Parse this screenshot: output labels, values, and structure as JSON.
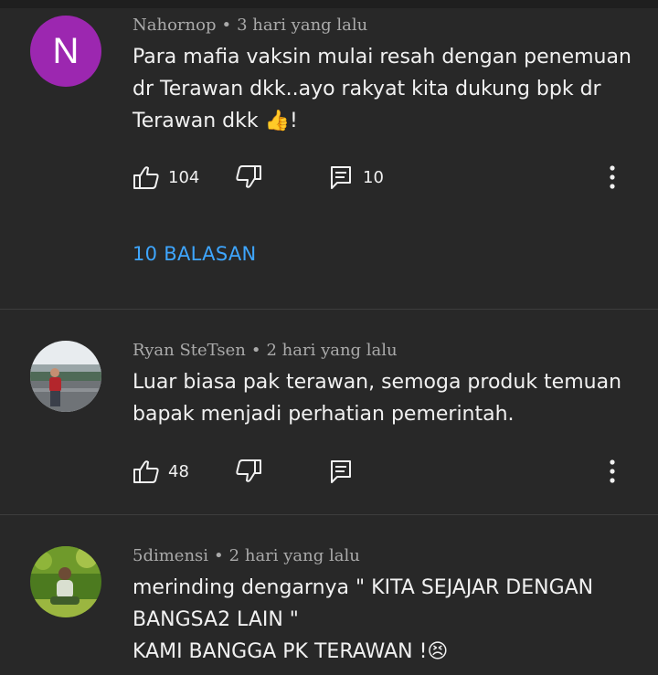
{
  "comments": [
    {
      "author": "Nahornop",
      "time": "3 hari yang lalu",
      "avatar_letter": "N",
      "avatar_color": "#9c27b0",
      "lines": [
        "Para mafia vaksin mulai resah dengan penemuan",
        "dr Terawan dkk..ayo rakyat kita dukung bpk dr",
        "Terawan dkk 👍!"
      ],
      "likes": "104",
      "replies_count": "10",
      "replies_label": "10 BALASAN"
    },
    {
      "author": "Ryan SteTsen",
      "time": "2 hari yang lalu",
      "avatar_image": "person-photo-outdoor",
      "lines": [
        "Luar biasa pak terawan, semoga produk temuan",
        "bapak menjadi perhatian pemerintah."
      ],
      "likes": "48"
    },
    {
      "author": "5dimensi",
      "time": "2 hari yang lalu",
      "avatar_image": "person-photo-grass",
      "lines": [
        "merinding dengarnya \" KITA SEJAJAR DENGAN",
        "BANGSA2 LAIN \"",
        "KAMI BANGGA PK TERAWAN !😣"
      ]
    }
  ],
  "separator": "•",
  "icons": {
    "like": "thumbs-up-icon",
    "dislike": "thumbs-down-icon",
    "reply": "reply-icon",
    "more": "more-vert-icon"
  },
  "colors": {
    "background": "#282828",
    "link": "#3ea6ff",
    "meta": "#aaaaaa"
  }
}
